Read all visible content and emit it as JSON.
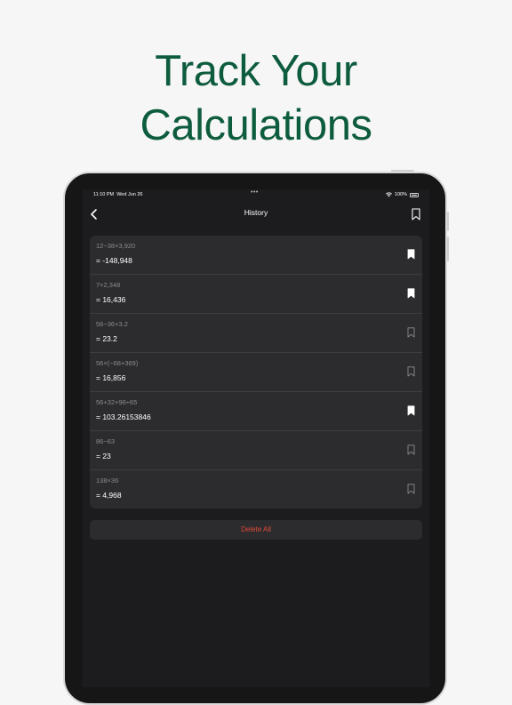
{
  "headline": {
    "line1": "Track Your",
    "line2": "Calculations"
  },
  "status_bar": {
    "time": "11:10 PM",
    "date": "Wed Jun 26",
    "dots": "•••",
    "battery": "100%"
  },
  "navbar": {
    "title": "History",
    "back_icon": "chevron-left-icon",
    "bookmark_icon": "bookmark-icon"
  },
  "history": [
    {
      "expression": "12−38×3,920",
      "result": "= -148,948",
      "bookmarked": true
    },
    {
      "expression": "7×2,348",
      "result": "= 16,436",
      "bookmarked": true
    },
    {
      "expression": "56−36+3.2",
      "result": "= 23.2",
      "bookmarked": false
    },
    {
      "expression": "56×(−68+369)",
      "result": "= 16,856",
      "bookmarked": false
    },
    {
      "expression": "56+32×96÷65",
      "result": "= 103.26153846",
      "bookmarked": true
    },
    {
      "expression": "86−63",
      "result": "= 23",
      "bookmarked": false
    },
    {
      "expression": "138×36",
      "result": "= 4,968",
      "bookmarked": false
    }
  ],
  "delete_all_label": "Delete All",
  "colors": {
    "headline": "#0e5c3e",
    "screen_bg": "#1c1c1e",
    "card_bg": "#2c2c2e",
    "delete": "#e04a3a",
    "bookmark_filled": "#ffffff",
    "bookmark_outline": "#8b8b8e"
  }
}
